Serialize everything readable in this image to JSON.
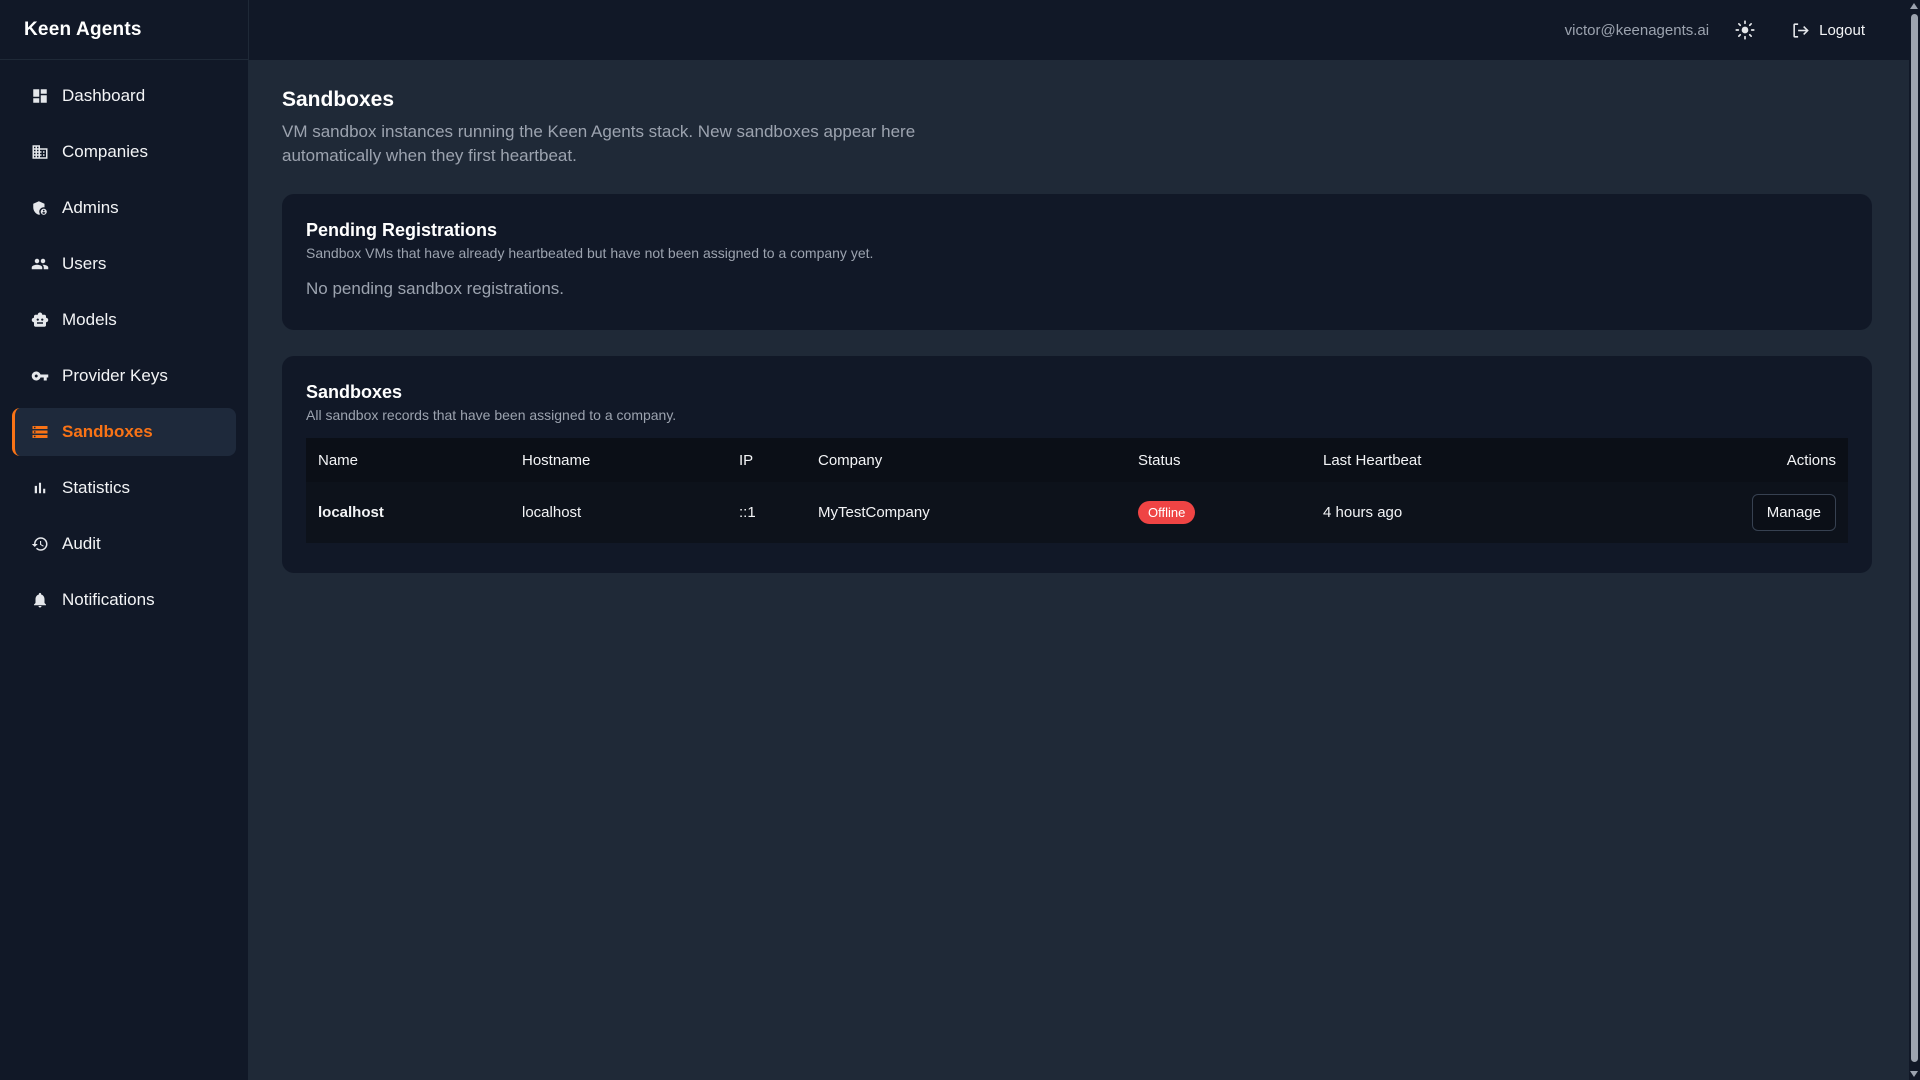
{
  "app": {
    "name": "Keen Agents"
  },
  "header": {
    "user_email": "victor@keenagents.ai",
    "logout_label": "Logout"
  },
  "sidebar": {
    "items": [
      {
        "label": "Dashboard",
        "icon": "dashboard-icon"
      },
      {
        "label": "Companies",
        "icon": "building-icon"
      },
      {
        "label": "Admins",
        "icon": "admin-shield-icon"
      },
      {
        "label": "Users",
        "icon": "users-icon"
      },
      {
        "label": "Models",
        "icon": "robot-icon"
      },
      {
        "label": "Provider Keys",
        "icon": "key-icon"
      },
      {
        "label": "Sandboxes",
        "icon": "server-icon",
        "active": true
      },
      {
        "label": "Statistics",
        "icon": "bar-chart-icon"
      },
      {
        "label": "Audit",
        "icon": "history-icon"
      },
      {
        "label": "Notifications",
        "icon": "bell-icon"
      }
    ]
  },
  "page": {
    "title": "Sandboxes",
    "description": "VM sandbox instances running the Keen Agents stack. New sandboxes appear here automatically when they first heartbeat."
  },
  "pending": {
    "title": "Pending Registrations",
    "subtitle": "Sandbox VMs that have already heartbeated but have not been assigned to a company yet.",
    "empty_message": "No pending sandbox registrations."
  },
  "sandboxes": {
    "title": "Sandboxes",
    "subtitle": "All sandbox records that have been assigned to a company.",
    "columns": [
      "Name",
      "Hostname",
      "IP",
      "Company",
      "Status",
      "Last Heartbeat",
      "Actions"
    ],
    "rows": [
      {
        "name": "localhost",
        "hostname": "localhost",
        "ip": "::1",
        "company": "MyTestCompany",
        "status": "Offline",
        "last_heartbeat": "4 hours ago",
        "action": "Manage"
      }
    ]
  },
  "colors": {
    "accent": "#f97316",
    "offline": "#ef4444",
    "sidebar_bg": "#111827",
    "main_bg": "#1f2937"
  }
}
